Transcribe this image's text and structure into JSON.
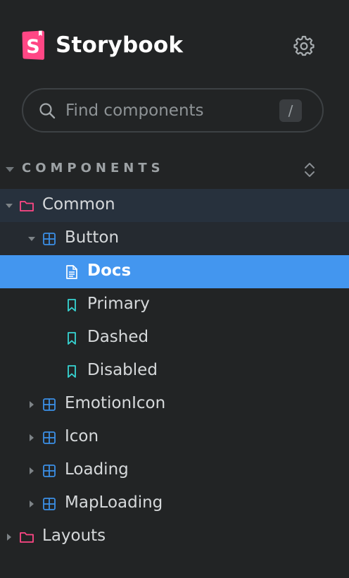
{
  "brand": {
    "logo_letter": "S",
    "name": "Storybook",
    "accent_color": "#ff4785"
  },
  "settings": {
    "icon": "gear-icon"
  },
  "search": {
    "placeholder": "Find components",
    "shortcut": "/"
  },
  "section": {
    "label": "COMPONENTS",
    "expand_icon": "expand-collapse-icon"
  },
  "tree": {
    "common": {
      "label": "Common",
      "icon": "folder-icon",
      "expanded": true
    },
    "button": {
      "label": "Button",
      "icon": "component-icon",
      "expanded": true
    },
    "docs": {
      "label": "Docs",
      "icon": "document-icon",
      "selected": true
    },
    "primary": {
      "label": "Primary",
      "icon": "bookmark-icon"
    },
    "dashed": {
      "label": "Dashed",
      "icon": "bookmark-icon"
    },
    "disabled": {
      "label": "Disabled",
      "icon": "bookmark-icon"
    },
    "emotion_icon": {
      "label": "EmotionIcon",
      "icon": "component-icon",
      "expanded": false
    },
    "icon": {
      "label": "Icon",
      "icon": "component-icon",
      "expanded": false
    },
    "loading": {
      "label": "Loading",
      "icon": "component-icon",
      "expanded": false
    },
    "map_loading": {
      "label": "MapLoading",
      "icon": "component-icon",
      "expanded": false
    },
    "layouts": {
      "label": "Layouts",
      "icon": "folder-icon",
      "expanded": false
    }
  },
  "colors": {
    "background": "#222425",
    "selected": "#4396ef",
    "folder": "#ff4785",
    "component": "#3b8fe6",
    "story": "#37d5d3"
  }
}
